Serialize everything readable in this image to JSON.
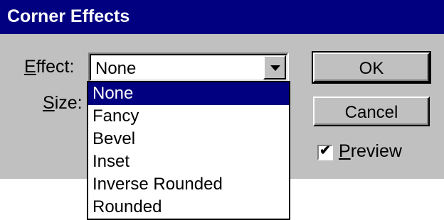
{
  "window": {
    "title": "Corner Effects"
  },
  "form": {
    "effect_label_accel": "E",
    "effect_label_rest": "ffect:",
    "size_label_accel": "S",
    "size_label_rest": "ize:",
    "effect_value": "None",
    "options": [
      "None",
      "Fancy",
      "Bevel",
      "Inset",
      "Inverse Rounded",
      "Rounded"
    ],
    "selected_option": "None"
  },
  "buttons": {
    "ok": "OK",
    "cancel": "Cancel"
  },
  "preview": {
    "label_accel": "P",
    "label_rest": "review",
    "checked": true
  },
  "colors": {
    "titlebar": "#000080",
    "dialog_bg": "#c0c0c0",
    "selection": "#000080"
  }
}
